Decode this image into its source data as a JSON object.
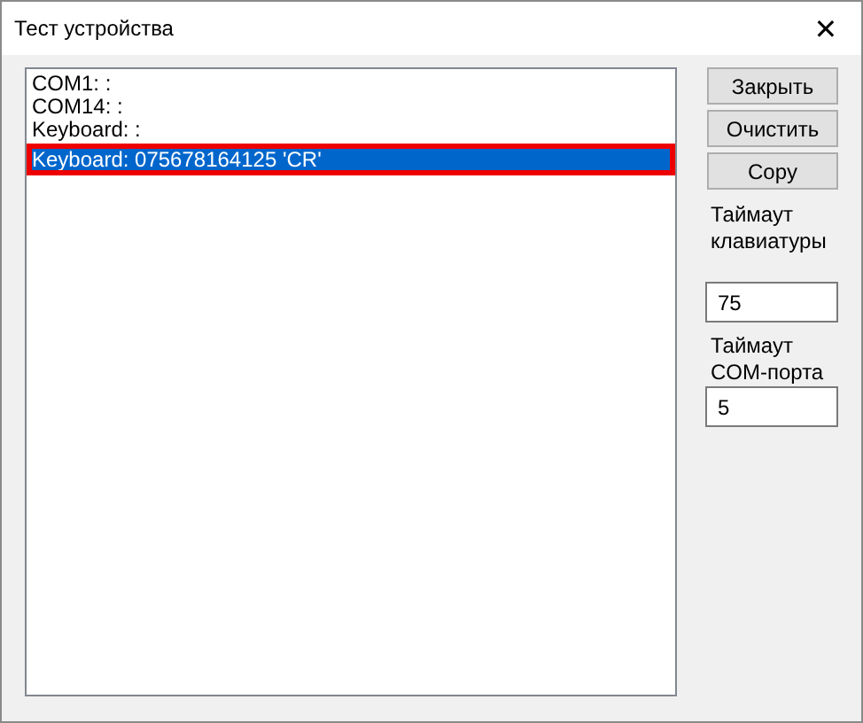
{
  "window": {
    "title": "Тест устройства",
    "close": "✕"
  },
  "list": {
    "items": [
      {
        "text": "COM1: :",
        "selected": false
      },
      {
        "text": "COM14: :",
        "selected": false
      },
      {
        "text": "Keyboard: :",
        "selected": false
      },
      {
        "text": "Keyboard: 075678164125 'CR'",
        "selected": true
      }
    ]
  },
  "buttons": [
    "Закрыть",
    "Очистить",
    "Copy"
  ],
  "fields": [
    {
      "label": "Таймаут клавиатуры",
      "value": "75"
    },
    {
      "label": "Таймаут COM-порта",
      "value": "5"
    }
  ]
}
